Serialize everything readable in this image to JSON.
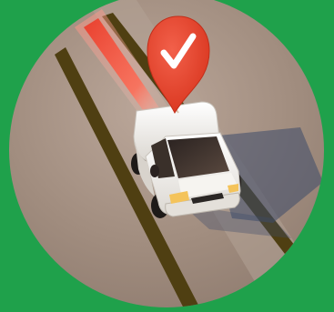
{
  "illustration": {
    "background_color": "#1fa14b",
    "road_color": "#a08c7e",
    "stripe_color": "#4f3f12",
    "trail_color": "#e8402e",
    "vehicle_color": "#f4f2ee",
    "pin_color": "#e8452f",
    "pin_icon": "checkmark-icon"
  }
}
